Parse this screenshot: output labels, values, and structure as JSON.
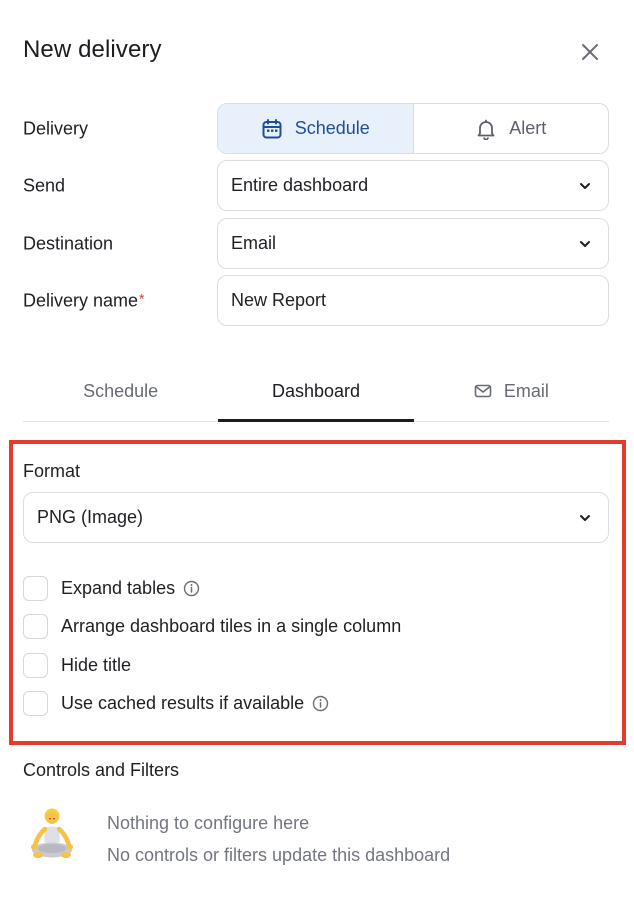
{
  "header": {
    "title": "New delivery"
  },
  "form": {
    "delivery": {
      "label": "Delivery",
      "options": [
        {
          "label": "Schedule",
          "icon": "calendar-icon",
          "active": true
        },
        {
          "label": "Alert",
          "icon": "bell-icon",
          "active": false
        }
      ]
    },
    "send": {
      "label": "Send",
      "value": "Entire dashboard"
    },
    "destination": {
      "label": "Destination",
      "value": "Email"
    },
    "delivery_name": {
      "label": "Delivery name",
      "required_mark": "*",
      "value": "New Report"
    }
  },
  "tabs": [
    {
      "label": "Schedule",
      "active": false
    },
    {
      "label": "Dashboard",
      "active": true
    },
    {
      "label": "Email",
      "icon": "mail-icon",
      "active": false
    }
  ],
  "format": {
    "label": "Format",
    "value": "PNG (Image)",
    "options": [
      {
        "label": "Expand tables",
        "checked": false,
        "info": true
      },
      {
        "label": "Arrange dashboard tiles in a single column",
        "checked": false,
        "info": false
      },
      {
        "label": "Hide title",
        "checked": false,
        "info": false
      },
      {
        "label": "Use cached results if available",
        "checked": false,
        "info": true
      }
    ]
  },
  "controls": {
    "title": "Controls and Filters",
    "empty_title": "Nothing to configure here",
    "empty_subtitle": "No controls or filters update this dashboard"
  },
  "colors": {
    "accent": "#1f4e9a",
    "accent_bg": "#e8f1fb",
    "highlight": "#e33b2e",
    "required": "#d9322b"
  }
}
